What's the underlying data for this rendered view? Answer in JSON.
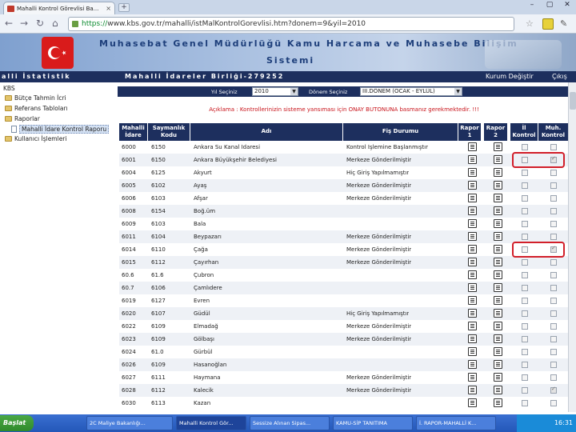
{
  "browser": {
    "tab_title": "Mahalli Kontrol Görevlisi Ba...",
    "tab_close": "×",
    "new_tab": "+",
    "window_buttons": [
      "–",
      "▢",
      "✕"
    ],
    "nav_icons": [
      "←",
      "→",
      "↻",
      "⌂"
    ],
    "url_scheme": "https://",
    "url_rest": "www.kbs.gov.tr/mahalli/istMalKontrolGorevlisi.htm?donem=9&yil=2010"
  },
  "banner": {
    "line1": "Muhasebat Genel Müdürlüğü Kamu Harcama ve Muhasebe Bilişim",
    "line2": "Sistemi"
  },
  "menubar": {
    "left": "alli İstatistik",
    "center": "Mahalli İdareler Birliği-279252",
    "link1": "Kurum Değiştir",
    "link2": "Çıkış"
  },
  "tree": {
    "root": "KBS",
    "items": [
      "Bütçe Tahmin İcri",
      "Referans Tabloları",
      "Raporlar",
      "Mahalli İdare Kontrol Raporu",
      "Kullanıcı İşlemleri"
    ]
  },
  "filter": {
    "year_label": "Yıl Seçiniz",
    "year_value": "2010",
    "period_label": "Dönem Seçiniz",
    "period_value": "III.DÖNEM (OCAK - EYLÜL)"
  },
  "notice": "Açıklama : Kontrollerinizin sisteme yansıması için ONAY BUTONUNA basmanız gerekmektedir. !!!",
  "table": {
    "headers": [
      "Mahalli İdare",
      "Saymanlık Kodu",
      "Adı",
      "Fiş Durumu",
      "Rapor 1",
      "Rapor 2",
      "İl Kontrol",
      "Muh. Kontrol"
    ],
    "rows": [
      {
        "idare": "6000",
        "kod": "6150",
        "adi": "Ankara Su Kanal İdaresi",
        "fis": "Kontrol İşlemine Başlanmıştır",
        "il": false,
        "muh": false
      },
      {
        "idare": "6001",
        "kod": "6150",
        "adi": "Ankara Büyükşehir Belediyesi",
        "fis": "Merkeze Gönderilmiştir",
        "il": false,
        "muh": true
      },
      {
        "idare": "6004",
        "kod": "6125",
        "adi": "Akyurt",
        "fis": "Hiç Giriş Yapılmamıştır",
        "il": false,
        "muh": false
      },
      {
        "idare": "6005",
        "kod": "6102",
        "adi": "Ayaş",
        "fis": "Merkeze Gönderilmiştir",
        "il": false,
        "muh": false
      },
      {
        "idare": "6006",
        "kod": "6103",
        "adi": "Afşar",
        "fis": "Merkeze Gönderilmiştir",
        "il": false,
        "muh": false
      },
      {
        "idare": "6008",
        "kod": "6154",
        "adi": "Boğ.üm",
        "fis": "",
        "il": false,
        "muh": false
      },
      {
        "idare": "6009",
        "kod": "6103",
        "adi": "Bala",
        "fis": "",
        "il": false,
        "muh": false
      },
      {
        "idare": "6011",
        "kod": "6104",
        "adi": "Beypazarı",
        "fis": "Merkeze Gönderilmiştir",
        "il": false,
        "muh": false
      },
      {
        "idare": "6014",
        "kod": "6110",
        "adi": "Çağa",
        "fis": "Merkeze Gönderilmiştir",
        "il": false,
        "muh": true
      },
      {
        "idare": "6015",
        "kod": "6112",
        "adi": "Çayırhan",
        "fis": "Merkeze Gönderilmiştir",
        "il": false,
        "muh": false
      },
      {
        "idare": "60.6",
        "kod": "61.6",
        "adi": "Çubron",
        "fis": "",
        "il": false,
        "muh": false
      },
      {
        "idare": "60.7",
        "kod": "6106",
        "adi": "Çamlıdere",
        "fis": "",
        "il": false,
        "muh": false
      },
      {
        "idare": "6019",
        "kod": "6127",
        "adi": "Evren",
        "fis": "",
        "il": false,
        "muh": false
      },
      {
        "idare": "6020",
        "kod": "6107",
        "adi": "Güdül",
        "fis": "Hiç Giriş Yapılmamıştır",
        "il": false,
        "muh": false
      },
      {
        "idare": "6022",
        "kod": "6109",
        "adi": "Elmadağ",
        "fis": "Merkeze Gönderilmiştir",
        "il": false,
        "muh": false
      },
      {
        "idare": "6023",
        "kod": "6109",
        "adi": "Gölbaşı",
        "fis": "Merkeze Gönderilmiştir",
        "il": false,
        "muh": false
      },
      {
        "idare": "6024",
        "kod": "61.0",
        "adi": "Gürbül",
        "fis": "",
        "il": false,
        "muh": false
      },
      {
        "idare": "6026",
        "kod": "6109",
        "adi": "Hasanoğlan",
        "fis": "",
        "il": false,
        "muh": false
      },
      {
        "idare": "6027",
        "kod": "6111",
        "adi": "Haymana",
        "fis": "Merkeze Gönderilmiştir",
        "il": false,
        "muh": false
      },
      {
        "idare": "6028",
        "kod": "6112",
        "adi": "Kalecik",
        "fis": "Merkeze Gönderilmiştir",
        "il": false,
        "muh": true
      },
      {
        "idare": "6030",
        "kod": "6113",
        "adi": "Kazan",
        "fis": "",
        "il": false,
        "muh": false
      }
    ]
  },
  "taskbar": {
    "start": "Başlat",
    "items": [
      "2C Maliye Bakanlığı...",
      "Mahalli Kontrol Gör...",
      "Sessize Alınan Sipas...",
      "KAMU-SİP TANITIMA",
      "İ. RAPOR-MAHALLİ K..."
    ],
    "clock": "16:31"
  }
}
